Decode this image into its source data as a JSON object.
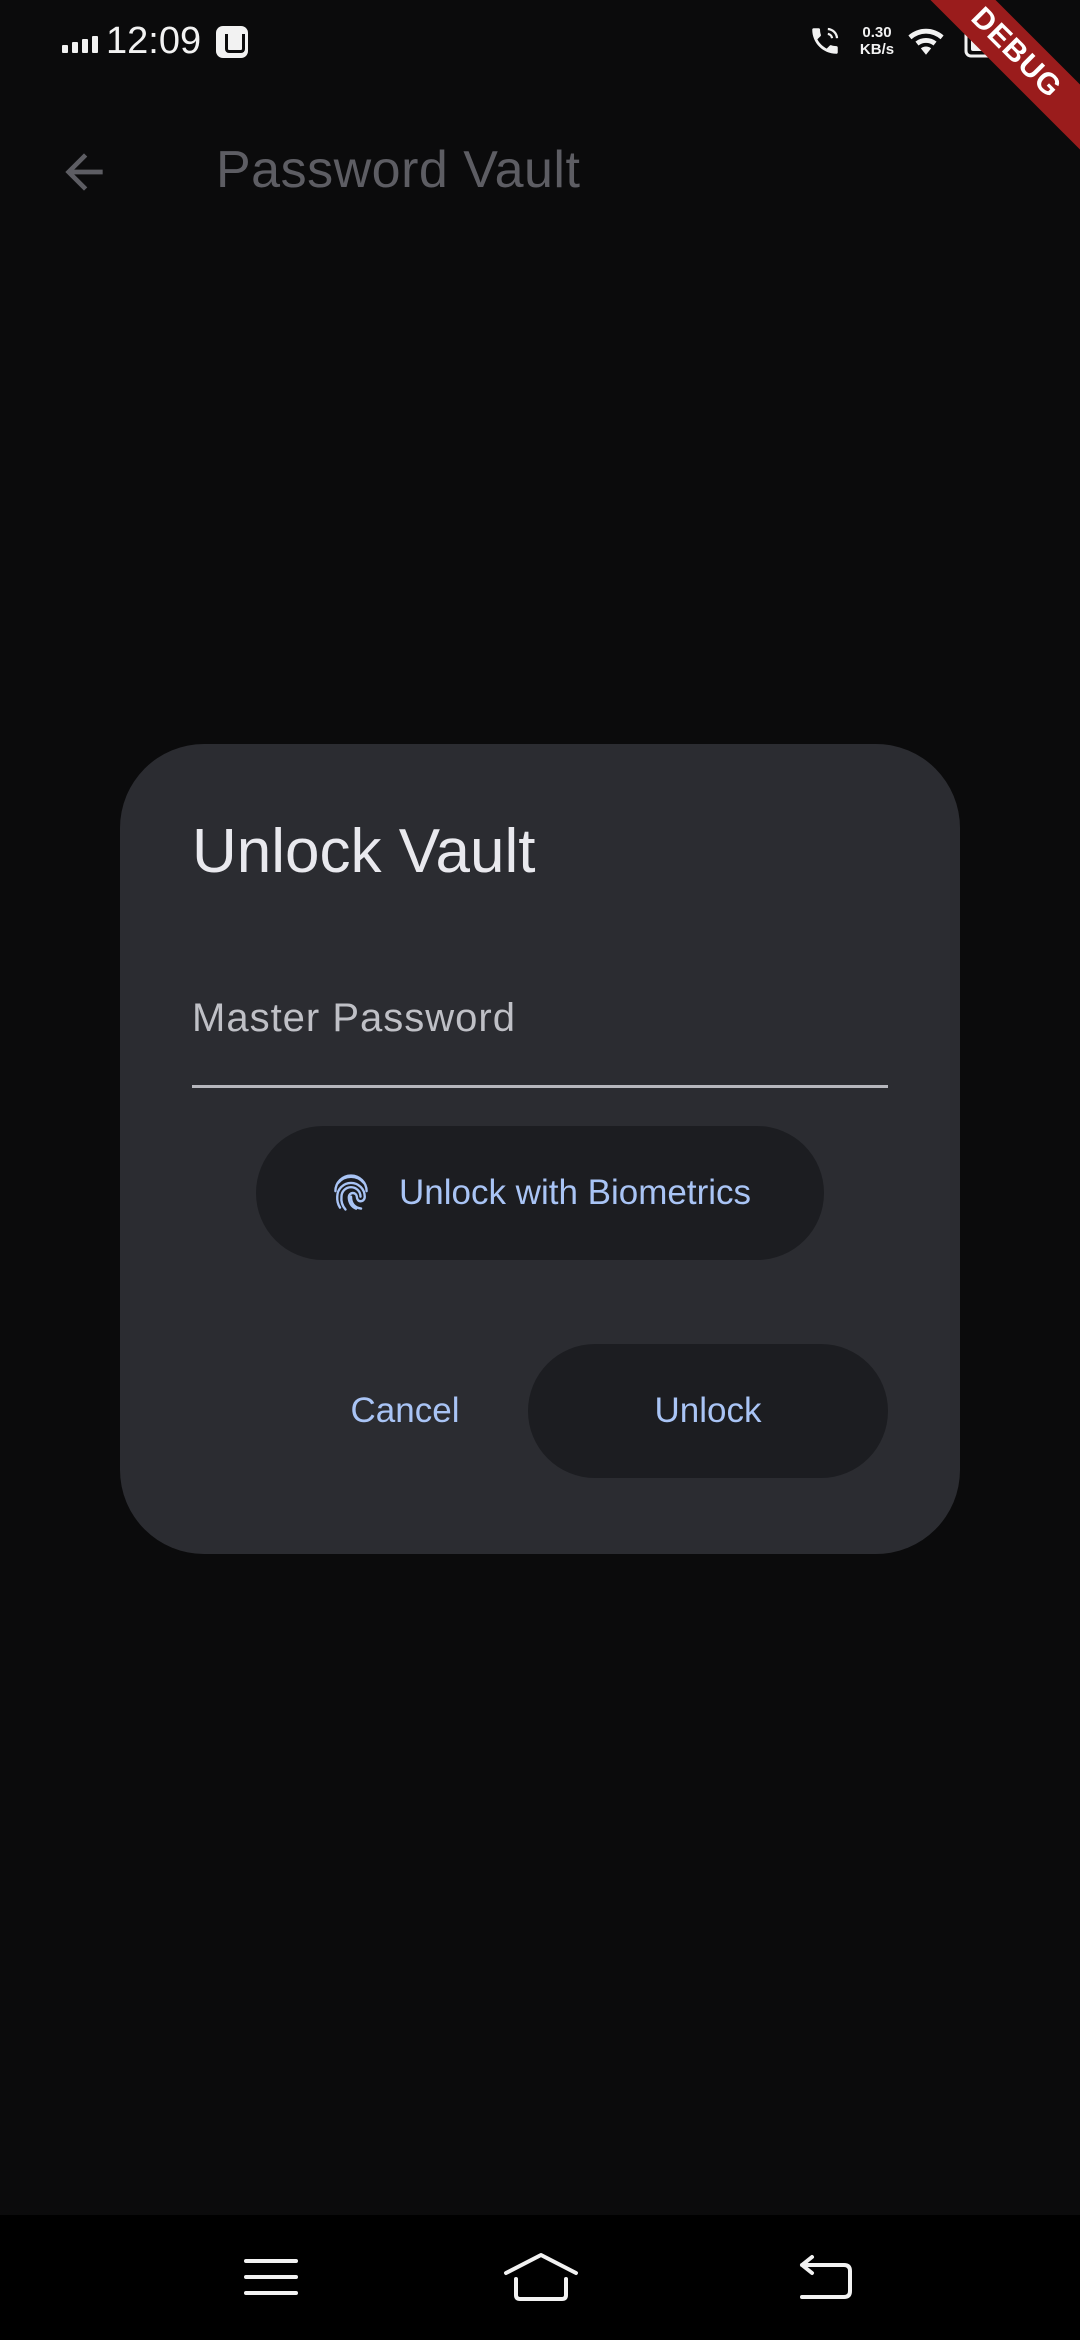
{
  "status_bar": {
    "time": "12:09",
    "net_speed_value": "0.30",
    "net_speed_unit": "KB/s",
    "icons": [
      "signal-icon",
      "notification-icon",
      "call-icon",
      "wifi-icon",
      "battery-icon"
    ]
  },
  "debug_banner": "DEBUG",
  "app_bar": {
    "title": "Password Vault",
    "back_icon": "arrow-back-icon"
  },
  "dialog": {
    "title": "Unlock Vault",
    "password_field": {
      "placeholder": "Master Password",
      "value": ""
    },
    "biometrics_button": {
      "label": "Unlock with Biometrics",
      "icon": "fingerprint-icon"
    },
    "cancel_label": "Cancel",
    "unlock_label": "Unlock"
  },
  "nav_bar": {
    "buttons": [
      "menu-icon",
      "home-icon",
      "back-icon"
    ]
  },
  "colors": {
    "background": "#0b0b0c",
    "dialog": "#2b2c31",
    "accent": "#a9c4f5",
    "tonal_button": "#1c1d21",
    "debug_ribbon": "#9a1c1c"
  }
}
